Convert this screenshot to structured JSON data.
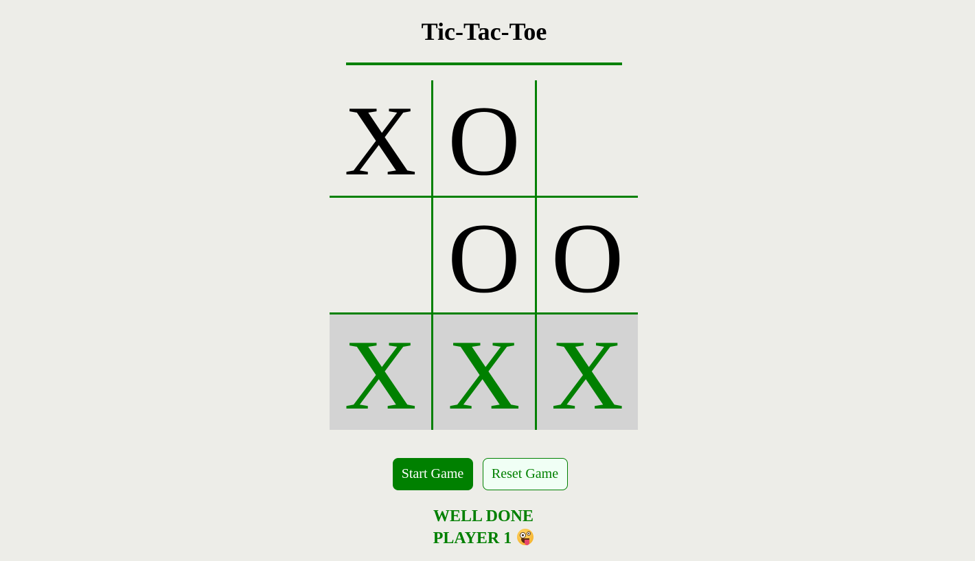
{
  "title": "Tic-Tac-Toe",
  "board": {
    "cells": [
      {
        "mark": "X",
        "winning": false
      },
      {
        "mark": "O",
        "winning": false
      },
      {
        "mark": "",
        "winning": false
      },
      {
        "mark": "",
        "winning": false
      },
      {
        "mark": "O",
        "winning": false
      },
      {
        "mark": "O",
        "winning": false
      },
      {
        "mark": "X",
        "winning": true
      },
      {
        "mark": "X",
        "winning": true
      },
      {
        "mark": "X",
        "winning": true
      }
    ]
  },
  "controls": {
    "start_label": "Start Game",
    "reset_label": "Reset Game"
  },
  "result": {
    "line1": "WELL DONE",
    "line2": "PLAYER 1",
    "emoji_icon": "zany-face-icon"
  },
  "colors": {
    "accent": "#008000",
    "background": "#ededE8",
    "win_cell": "#d3d3d3"
  }
}
